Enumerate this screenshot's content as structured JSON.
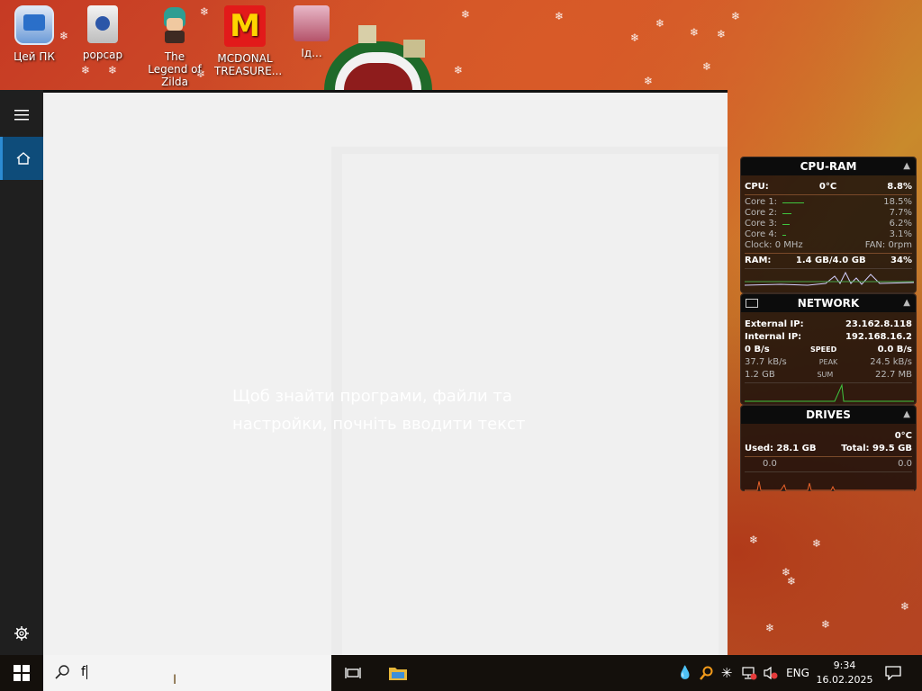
{
  "desktop": {
    "icons": [
      {
        "label": "Цей ПК"
      },
      {
        "label": "popcap"
      },
      {
        "label": "The Legend of Zilda"
      },
      {
        "label": "MCDONAL TREASURE..."
      },
      {
        "label": "Ід..."
      }
    ]
  },
  "start_menu": {
    "hint_text": "Щоб знайти програми, файли та настройки, почніть вводити текст"
  },
  "search": {
    "value": "f"
  },
  "gadgets": {
    "cpu_ram": {
      "title": "CPU-RAM",
      "cpu_label": "CPU:",
      "cpu_temp": "0°C",
      "cpu_value": "8.8%",
      "cores": [
        {
          "label": "Core 1:",
          "value": "18.5%",
          "fraction": 0.185
        },
        {
          "label": "Core 2:",
          "value": "7.7%",
          "fraction": 0.077
        },
        {
          "label": "Core 3:",
          "value": "6.2%",
          "fraction": 0.062
        },
        {
          "label": "Core 4:",
          "value": "3.1%",
          "fraction": 0.031
        }
      ],
      "clock": "Clock: 0 MHz",
      "fan": "FAN: 0rpm",
      "ram_label": "RAM:",
      "ram_amount": "1.4 GB/4.0 GB",
      "ram_value": "34%"
    },
    "network": {
      "title": "NETWORK",
      "external_label": "External IP:",
      "external_ip": "23.162.8.118",
      "internal_label": "Internal IP:",
      "internal_ip": "192.168.16.2",
      "speed_left": "0 B/s",
      "speed_label": "SPEED",
      "speed_right": "0.0 B/s",
      "peak_left": "37.7 kB/s",
      "peak_label": "PEAK",
      "peak_right": "24.5 kB/s",
      "sum_left": "1.2 GB",
      "sum_label": "SUM",
      "sum_right": "22.7 MB"
    },
    "drives": {
      "title": "DRIVES",
      "temp": "0°C",
      "used": "Used: 28.1 GB",
      "total": "Total: 99.5 GB",
      "io_left": "0.0",
      "io_right": "0.0"
    }
  },
  "taskbar": {
    "language": "ENG",
    "time": "9:34",
    "date": "16.02.2025"
  }
}
